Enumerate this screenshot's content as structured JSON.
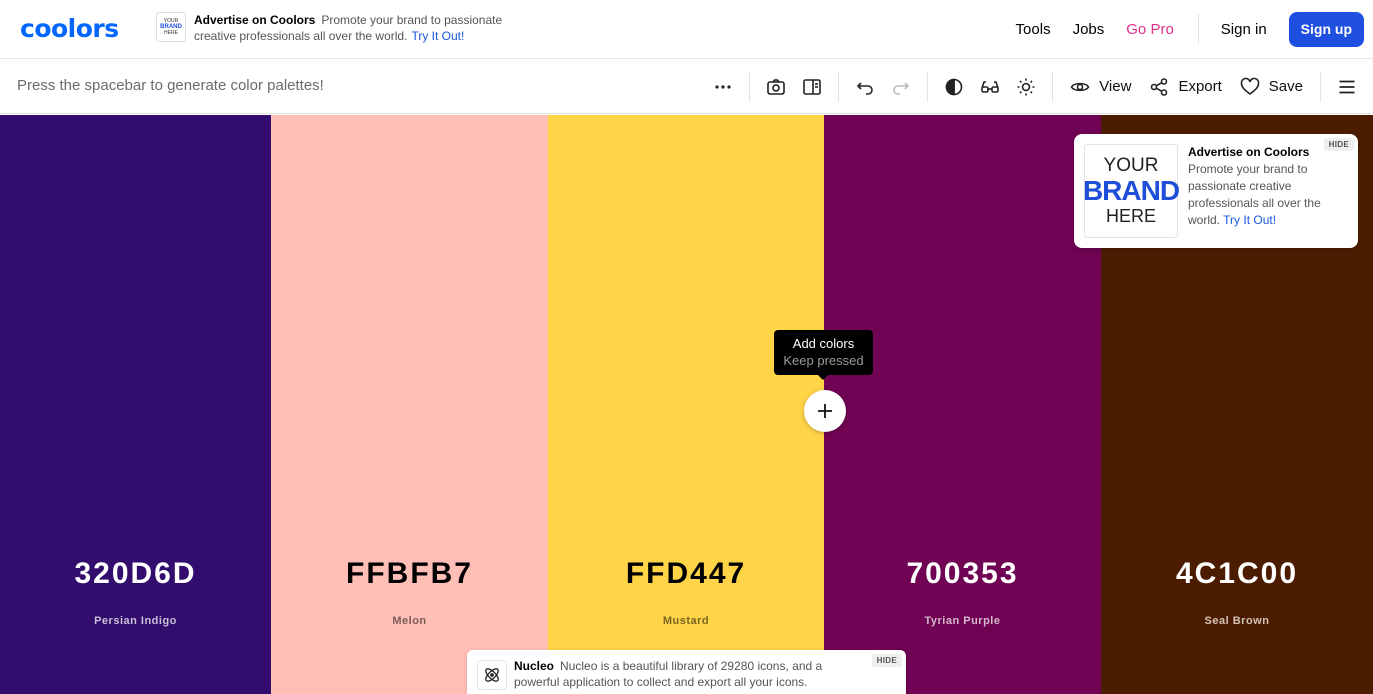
{
  "brand": {
    "logo": "coolors",
    "color": "#0066ff"
  },
  "top_ad": {
    "thumb_lines": [
      "YOUR",
      "BRAND",
      "HERE"
    ],
    "title": "Advertise on Coolors",
    "body": "Promote your brand to passionate creative professionals all over the world.",
    "cta": "Try It Out!"
  },
  "nav": {
    "tools": "Tools",
    "jobs": "Jobs",
    "gopro": "Go Pro",
    "signin": "Sign in",
    "signup": "Sign up"
  },
  "toolbar": {
    "hint": "Press the spacebar to generate color palettes!",
    "icons": [
      "more-icon",
      "camera-icon",
      "panel-icon",
      "undo-icon",
      "redo-icon",
      "contrast-icon",
      "glasses-icon",
      "sun-icon",
      "menu-icon"
    ],
    "view": "View",
    "export": "Export",
    "save": "Save"
  },
  "palette": [
    {
      "hex": "320D6D",
      "name": "Persian Indigo",
      "bg": "#320D6D",
      "fg": "#ffffff",
      "sub": "#c8bfd8"
    },
    {
      "hex": "FFBFB7",
      "name": "Melon",
      "bg": "#FFBFB7",
      "fg": "#000000",
      "sub": "#7a5c58"
    },
    {
      "hex": "FFD447",
      "name": "Mustard",
      "bg": "#FFD447",
      "fg": "#000000",
      "sub": "#7a6622"
    },
    {
      "hex": "700353",
      "name": "Tyrian Purple",
      "bg": "#700353",
      "fg": "#ffffff",
      "sub": "#d6b8cc"
    },
    {
      "hex": "4C1C00",
      "name": "Seal Brown",
      "bg": "#4C1C00",
      "fg": "#ffffff",
      "sub": "#d2c3b8"
    }
  ],
  "tooltip": {
    "title": "Add colors",
    "subtitle": "Keep pressed"
  },
  "side_ad": {
    "logo_lines": [
      "YOUR",
      "BRAND",
      "HERE"
    ],
    "title": "Advertise on Coolors",
    "body": "Promote your brand to passionate creative professionals all over the world.",
    "cta": "Try It Out!",
    "hide": "HIDE"
  },
  "bottom_ad": {
    "title": "Nucleo",
    "body": "Nucleo is a beautiful library of 29280 icons, and a powerful application to collect and export all your icons.",
    "hide": "HIDE"
  }
}
